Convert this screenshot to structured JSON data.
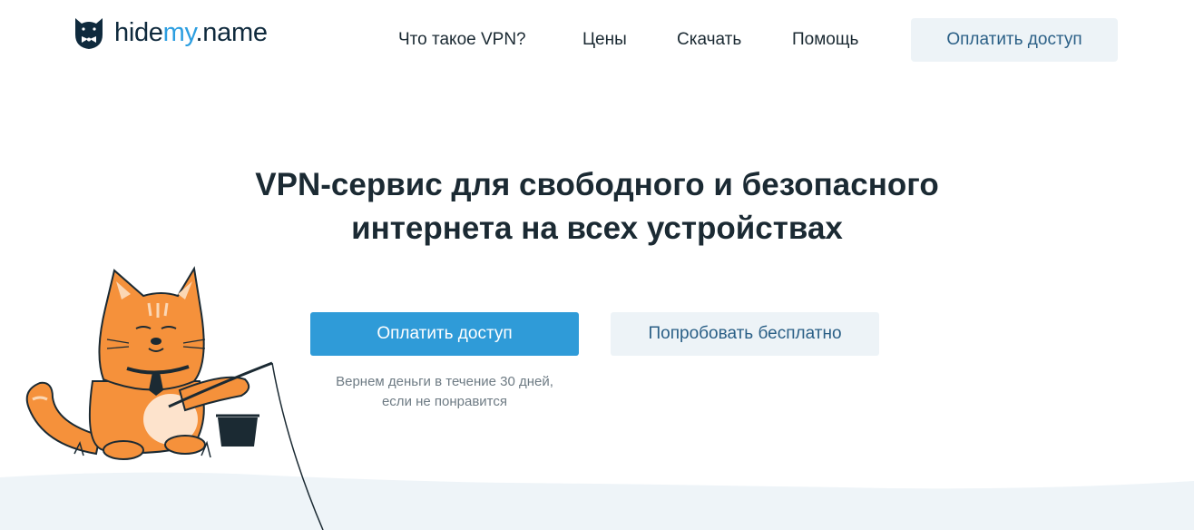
{
  "brand": {
    "logo_prefix": "hide",
    "logo_accent": "my",
    "logo_suffix": ".name"
  },
  "nav": {
    "items": [
      {
        "label": "Что такое VPN?"
      },
      {
        "label": "Цены"
      },
      {
        "label": "Скачать"
      },
      {
        "label": "Помощь"
      }
    ],
    "cta_label": "Оплатить доступ"
  },
  "hero": {
    "title_line1": "VPN-сервис для свободного и безопасного",
    "title_line2": "интернета на всех устройствах",
    "primary_button": "Оплатить доступ",
    "secondary_button": "Попробовать бесплатно",
    "note_line1": "Вернем деньги в течение 30 дней,",
    "note_line2": "если не понравится"
  },
  "icons": {
    "logo": "cat-bowtie-logo-icon",
    "illustration": "fishing-cat-illustration"
  },
  "colors": {
    "accent": "#2f9bd8",
    "logo_accent": "#2c9ee0",
    "text_dark": "#1b2a33",
    "light_button": "#edf3f7",
    "light_button_text": "#2a5f86",
    "muted_text": "#6e7b84",
    "cat_orange": "#f5913b"
  }
}
